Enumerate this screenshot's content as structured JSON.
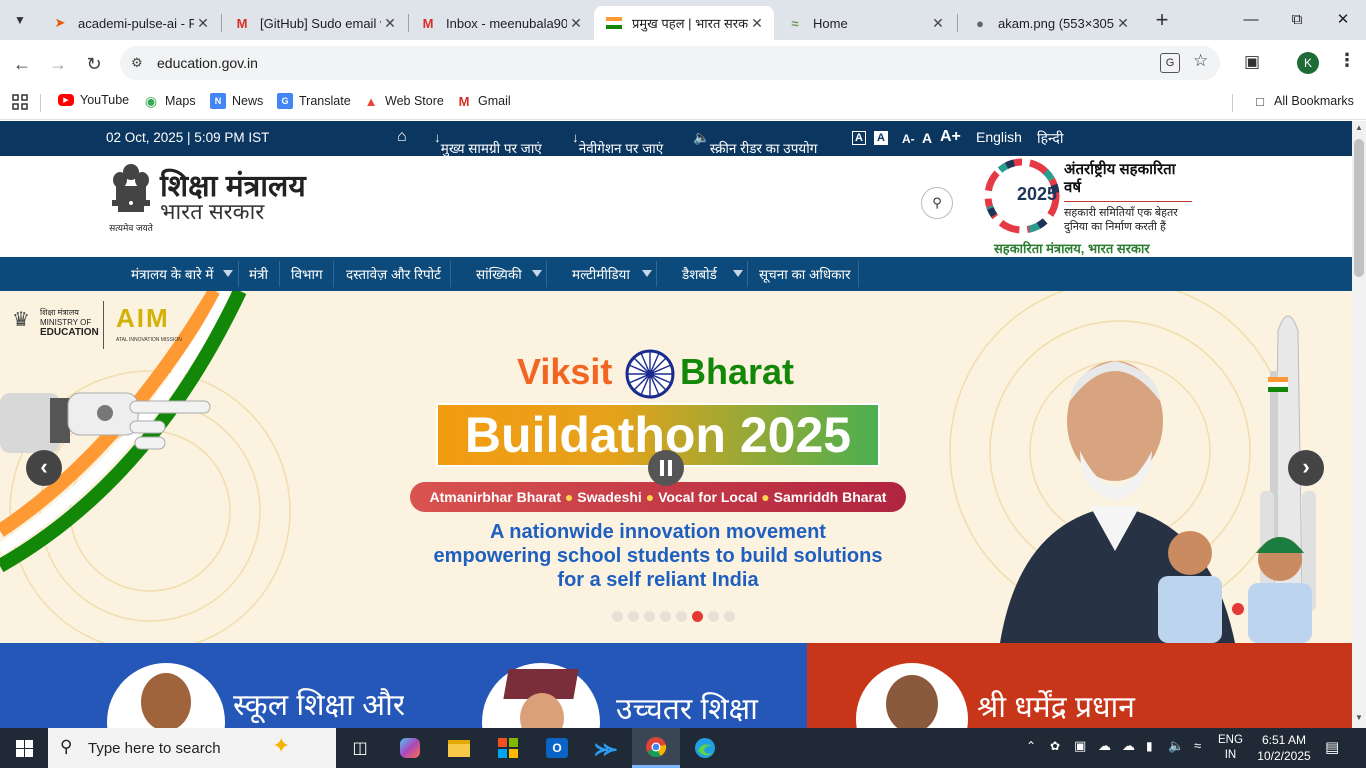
{
  "browser": {
    "tabs": [
      {
        "title": "academi-pulse-ai - Re",
        "icon": "netlify-icon",
        "color": "#e8590c"
      },
      {
        "title": "[GitHub] Sudo email v",
        "icon": "gmail-icon",
        "color": "#d93025"
      },
      {
        "title": "Inbox - meenubala90",
        "icon": "gmail-icon",
        "color": "#d93025"
      },
      {
        "title": "प्रमुख पहल | भारत सरक",
        "icon": "india-flag-icon",
        "color": "#ff9933",
        "active": true
      },
      {
        "title": "Home",
        "icon": "site-leaf-icon",
        "color": "#6a994e"
      },
      {
        "title": "akam.png (553×305)",
        "icon": "globe-icon",
        "color": "#5f6368"
      }
    ],
    "new_tab": "+",
    "url": "education.gov.in",
    "profile_initial": "K",
    "bookmarks": [
      {
        "label": "YouTube",
        "icon": "youtube-icon"
      },
      {
        "label": "Maps",
        "icon": "maps-pin-icon"
      },
      {
        "label": "News",
        "icon": "news-icon"
      },
      {
        "label": "Translate",
        "icon": "translate-icon"
      },
      {
        "label": "Web Store",
        "icon": "webstore-icon"
      },
      {
        "label": "Gmail",
        "icon": "gmail-icon"
      }
    ],
    "all_bookmarks": "All Bookmarks"
  },
  "site": {
    "topbar": {
      "datetime": "02 Oct, 2025 | 5:09 PM IST",
      "skip_main": "मुख्य सामग्री पर जाएं",
      "skip_nav": "नेवीगेशन पर जाएं",
      "screen_reader": "स्क्रीन रीडर का उपयोग",
      "contrast_a1": "A",
      "contrast_a2": "A",
      "font_minus": "A-",
      "font_normal": "A",
      "font_plus": "A+",
      "lang_english": "English",
      "lang_hindi": "हिन्दी"
    },
    "header": {
      "ministry_title": "शिक्षा मंत्रालय",
      "ministry_sub": "भारत सरकार",
      "emblem_motto": "सत्यमेव जयते",
      "coop_title": "अंतर्राष्ट्रीय सहकारिता वर्ष",
      "coop_year": "2025",
      "coop_tagline1": "सहकारी समितियाँ एक बेहतर",
      "coop_tagline2": "दुनिया का निर्माण करती हैं",
      "coop_ministry": "सहकारिता मंत्रालय, भारत सरकार"
    },
    "nav": [
      {
        "label": "मंत्रालय के बारे में",
        "dropdown": true
      },
      {
        "label": "मंत्री",
        "dropdown": false
      },
      {
        "label": "विभाग",
        "dropdown": false
      },
      {
        "label": "दस्तावेज़ और रिपोर्ट",
        "dropdown": false
      },
      {
        "label": "सांख्यिकी",
        "dropdown": true
      },
      {
        "label": "मल्टीमीडिया",
        "dropdown": true
      },
      {
        "label": "डैशबोर्ड",
        "dropdown": true
      },
      {
        "label": "सूचना का अधिकार",
        "dropdown": false
      }
    ],
    "hero": {
      "logo_hindi": "शिक्षा मंत्रालय",
      "logo_en1": "MINISTRY OF",
      "logo_en2": "EDUCATION",
      "aim_logo": "AIM",
      "aim_sub": "ATAL INNOVATION MISSION",
      "viksit": "Viksit",
      "bharat": "Bharat",
      "buildathon": "Buildathon 2025",
      "pill_items": [
        "Atmanirbhar Bharat",
        "Swadeshi",
        "Vocal for Local",
        "Samriddh Bharat"
      ],
      "desc1": "A nationwide innovation movement",
      "desc2": "empowering school students to build solutions",
      "desc3": "for a self reliant India",
      "dot_count": 8,
      "active_dot": 5
    },
    "cards": [
      {
        "title": "स्कूल शिक्षा और",
        "bg": "#2457b8"
      },
      {
        "title": "उच्चतर शिक्षा",
        "bg": "#2457b8"
      },
      {
        "title": "श्री धर्मेंद्र प्रधान",
        "bg": "#c8361a"
      }
    ]
  },
  "taskbar": {
    "search_placeholder": "Type here to search",
    "lang_top": "ENG",
    "lang_bottom": "IN",
    "time": "6:51 AM",
    "date": "10/2/2025"
  }
}
